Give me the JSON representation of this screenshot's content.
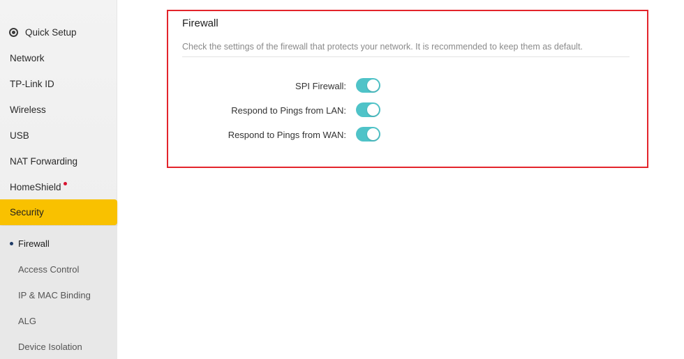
{
  "sidebar": {
    "items": [
      {
        "label": "Quick Setup",
        "icon": "quick-setup-icon"
      },
      {
        "label": "Network"
      },
      {
        "label": "TP-Link ID"
      },
      {
        "label": "Wireless"
      },
      {
        "label": "USB"
      },
      {
        "label": "NAT Forwarding"
      },
      {
        "label": "HomeShield",
        "badge": "red-dot"
      },
      {
        "label": "Security",
        "active": true
      }
    ],
    "sub_items": [
      {
        "label": "Firewall",
        "current": true
      },
      {
        "label": "Access Control"
      },
      {
        "label": "IP & MAC Binding"
      },
      {
        "label": "ALG"
      },
      {
        "label": "Device Isolation"
      }
    ]
  },
  "firewall": {
    "title": "Firewall",
    "description": "Check the settings of the firewall that protects your network. It is recommended to keep them as default.",
    "settings": [
      {
        "label": "SPI Firewall:",
        "enabled": true
      },
      {
        "label": "Respond to Pings from LAN:",
        "enabled": true
      },
      {
        "label": "Respond to Pings from WAN:",
        "enabled": true
      }
    ]
  },
  "colors": {
    "active_nav": "#f9c100",
    "toggle_on": "#4fc3c8",
    "highlight_border": "#e3242b",
    "notification_dot": "#d8122f"
  }
}
